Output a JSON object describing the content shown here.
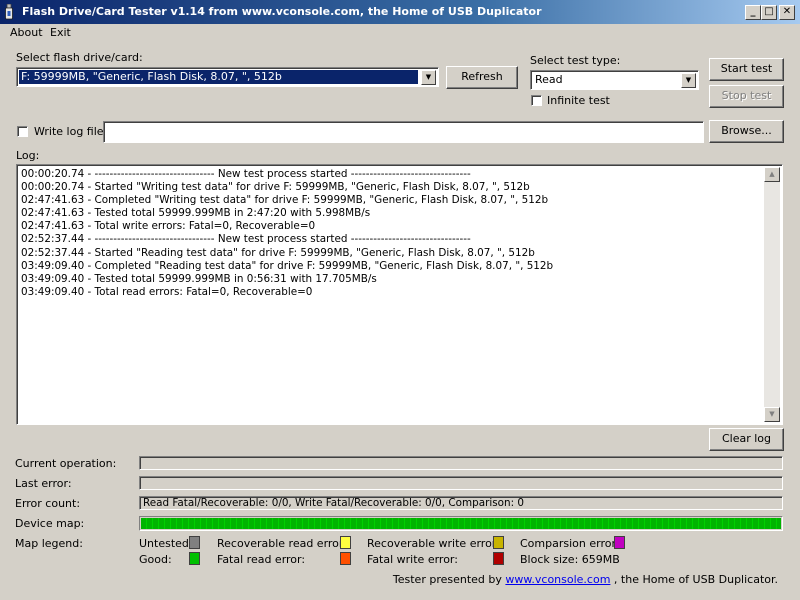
{
  "window": {
    "title": "Flash Drive/Card Tester v1.14 from www.vconsole.com, the Home of USB Duplicator"
  },
  "menu": {
    "about": "About",
    "exit": "Exit"
  },
  "drive": {
    "label": "Select flash drive/card:",
    "selected": "F: 59999MB, \"Generic, Flash Disk, 8.07, \", 512b",
    "refresh": "Refresh"
  },
  "testtype": {
    "label": "Select test type:",
    "selected": "Read",
    "infinite_label": "Infinite test",
    "infinite_checked": false
  },
  "buttons": {
    "start": "Start test",
    "stop": "Stop test",
    "browse": "Browse...",
    "clear": "Clear log"
  },
  "logfile": {
    "label": "Write log file",
    "checked": false,
    "path": ""
  },
  "log": {
    "label": "Log:",
    "lines": [
      "00:00:20.74 - -------------------------------- New test process started --------------------------------",
      "00:00:20.74 - Started \"Writing test data\" for drive F: 59999MB, \"Generic, Flash Disk, 8.07, \", 512b",
      "02:47:41.63 - Completed \"Writing test data\" for drive F: 59999MB, \"Generic, Flash Disk, 8.07, \", 512b",
      "02:47:41.63 - Tested total 59999.999MB in 2:47:20 with  5.998MB/s",
      "02:47:41.63 - Total write errors: Fatal=0, Recoverable=0",
      "02:52:37.44 - -------------------------------- New test process started --------------------------------",
      "02:52:37.44 - Started \"Reading test data\" for drive F: 59999MB, \"Generic, Flash Disk, 8.07, \", 512b",
      "03:49:09.40 - Completed \"Reading test data\" for drive F: 59999MB, \"Generic, Flash Disk, 8.07, \", 512b",
      "03:49:09.40 - Tested total 59999.999MB in 0:56:31 with 17.705MB/s",
      "03:49:09.40 - Total read errors: Fatal=0, Recoverable=0"
    ]
  },
  "status": {
    "current_operation_label": "Current operation:",
    "current_operation": "",
    "last_error_label": "Last error:",
    "last_error": "",
    "error_count_label": "Error count:",
    "error_count": "Read Fatal/Recoverable: 0/0, Write Fatal/Recoverable: 0/0, Comparison: 0",
    "device_map_label": "Device map:",
    "device_map_fill": 1.0
  },
  "legend": {
    "label": "Map legend:",
    "items": [
      {
        "label": "Untested:",
        "color": "#808080"
      },
      {
        "label": "Recoverable read error:",
        "color": "#ffff40"
      },
      {
        "label": "Recoverable write error:",
        "color": "#c8b400"
      },
      {
        "label": "Comparsion error:",
        "color": "#c000c0"
      },
      {
        "label": "Good:",
        "color": "#00c000"
      },
      {
        "label": "Fatal read error:",
        "color": "#ff5000"
      },
      {
        "label": "Fatal write error:",
        "color": "#b00000"
      }
    ],
    "block_size": "Block size: 659MB"
  },
  "footer": {
    "prefix": "Tester presented by",
    "link": "www.vconsole.com",
    "suffix": ", the Home of USB Duplicator."
  }
}
